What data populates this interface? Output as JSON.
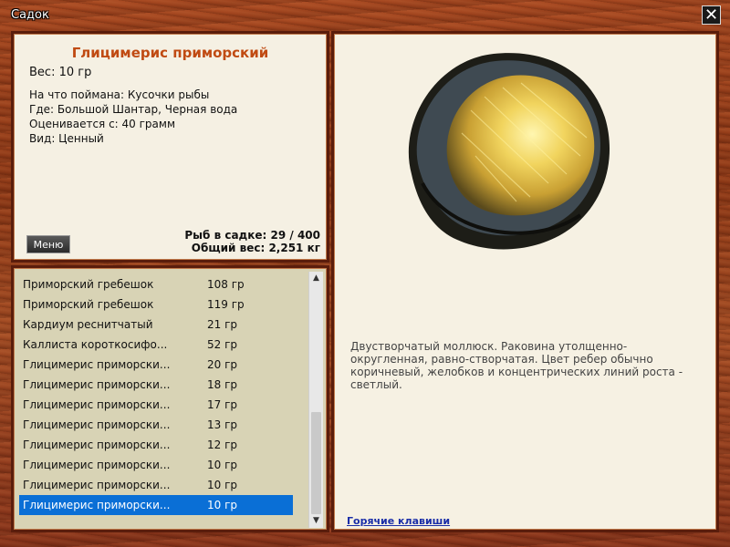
{
  "window": {
    "title": "Садок",
    "close_symbol": "✕"
  },
  "fish": {
    "name": "Глицимерис приморский",
    "weight": "Вес: 10 гр",
    "caught_with": "На что поймана: Кусочки рыбы",
    "location": "Где: Большой Шантар, Черная вода",
    "valued_from": "Оценивается с: 40 грамм",
    "kind": "Вид: Ценный",
    "description": "Двустворчатый моллюск. Раковина утолщенно-округленная, равно-створчатая. Цвет ребер обычно коричневый, желобков и концентрических линий роста - светлый."
  },
  "menu_button": "Меню",
  "stats": {
    "count": "Рыб в садке: 29 / 400",
    "total_weight": "Общий вес: 2,251 кг"
  },
  "catch_list": [
    {
      "name": "Приморский гребешок",
      "weight": "108 гр"
    },
    {
      "name": "Приморский гребешок",
      "weight": "119 гр"
    },
    {
      "name": "Кардиум реснитчатый",
      "weight": "21 гр"
    },
    {
      "name": "Каллиста короткосифо...",
      "weight": "52 гр"
    },
    {
      "name": "Глицимерис приморски...",
      "weight": "20 гр"
    },
    {
      "name": "Глицимерис приморски...",
      "weight": "18 гр"
    },
    {
      "name": "Глицимерис приморски...",
      "weight": "17 гр"
    },
    {
      "name": "Глицимерис приморски...",
      "weight": "13 гр"
    },
    {
      "name": "Глицимерис приморски...",
      "weight": "12 гр"
    },
    {
      "name": "Глицимерис приморски...",
      "weight": "10 гр"
    },
    {
      "name": "Глицимерис приморски...",
      "weight": "10 гр"
    },
    {
      "name": "Глицимерис приморски...",
      "weight": "10 гр",
      "selected": true
    }
  ],
  "scrollbar": {
    "up_symbol": "▲",
    "down_symbol": "▼"
  },
  "hotkeys_link": "Горячие клавиши",
  "colors": {
    "selected_row": "#0a6fd6",
    "fish_name": "#c04a12",
    "link": "#1a2ea8",
    "wood": "#9a4420"
  }
}
